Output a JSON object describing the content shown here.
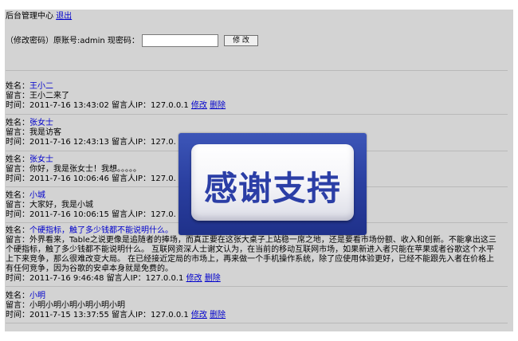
{
  "header": {
    "title": "后台管理中心",
    "logout_label": "退出"
  },
  "password_form": {
    "label": "（修改密码）原账号:admin 现密码：",
    "input_value": "",
    "submit_label": "修 改"
  },
  "messages": [
    {
      "name_label": "姓名：",
      "name": "王小二",
      "message_label": "留言：",
      "message": "王小二来了",
      "time_label": "时间：",
      "time": "2011-7-16 13:43:02",
      "ip_label": "留言人IP：",
      "ip": "127.0.0.1",
      "edit_label": "修改",
      "delete_label": "删除"
    },
    {
      "name_label": "姓名：",
      "name": "张女士",
      "message_label": "留言：",
      "message": "我是访客",
      "time_label": "时间：",
      "time": "2011-7-16 12:43:13",
      "ip_label": "留言人IP：",
      "ip": "127.0.",
      "edit_label": "",
      "delete_label": ""
    },
    {
      "name_label": "姓名：",
      "name": "张女士",
      "message_label": "留言：",
      "message": "你好，我是张女士！我想。。。。。",
      "time_label": "时间：",
      "time": "2011-7-16 10:06:46",
      "ip_label": "留言人IP：",
      "ip": "127.0.",
      "edit_label": "",
      "delete_label": ""
    },
    {
      "name_label": "姓名：",
      "name": "小城",
      "message_label": "留言：",
      "message": "大家好，我是小城",
      "time_label": "时间：",
      "time": "2011-7-16 10:06:15",
      "ip_label": "留言人IP：",
      "ip": "127.0.",
      "edit_label": "",
      "delete_label": ""
    },
    {
      "name_label": "姓名：",
      "name": "个硬指标，触了多少钱都不能说明什么。",
      "message_label": "留言：",
      "message": "外界看来，Table之说更像是追随者的捧场，而真正要在这张大桌子上站稳一席之地，还是要看市场份额、收入和创新。不能拿出这三个硬指标，触了多少钱都不能说明什么。 互联网资深人士谢文认为，在当前的移动互联网市场，如果新进入者只能在苹果或者谷歌这个水平上下来竞争，那么很难改变大局。 在已经接近定局的市场上，再来做一个手机操作系统，除了应使用体验更好，已经不能跟先入者在价格上有任何竞争，因为谷歌的安卓本身就是免费的。",
      "time_label": "时间：",
      "time": "2011-7-16 9:46:48",
      "ip_label": "留言人IP：",
      "ip": "127.0.0.1",
      "edit_label": "修改",
      "delete_label": "删除"
    },
    {
      "name_label": "姓名：",
      "name": "小明",
      "message_label": "留言：",
      "message": "小明小明小明小明小明小明",
      "time_label": "时间：",
      "time": "2011-7-15 13:37:55",
      "ip_label": "留言人IP：",
      "ip": "127.0.0.1",
      "edit_label": "修改",
      "delete_label": "删除"
    }
  ],
  "overlay_badge": {
    "text": "感谢支持",
    "bg_color": "#2a3fa0",
    "text_color": "#2b3ea6"
  }
}
